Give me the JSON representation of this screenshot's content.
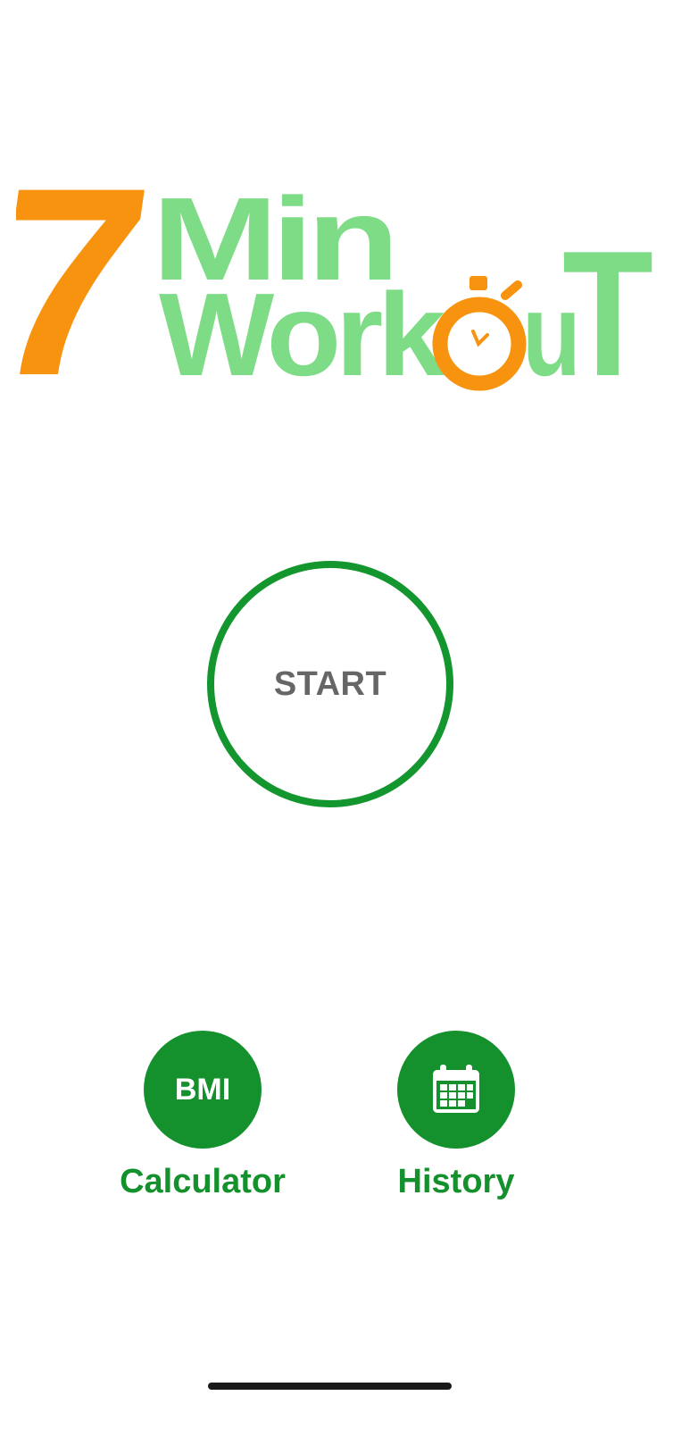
{
  "logo": {
    "digit": "7",
    "word_top": "Min",
    "word_bottom_part1": "Work",
    "word_bottom_part2": "u",
    "word_bottom_part3": "T",
    "accent_color": "#f7930f",
    "secondary_color": "#7edc86"
  },
  "start": {
    "label": "START",
    "ring_color": "#14962f"
  },
  "actions": {
    "bmi": {
      "badge_text": "BMI",
      "label": "Calculator"
    },
    "history": {
      "icon": "calendar-icon",
      "label": "History"
    },
    "color": "#14912d"
  }
}
